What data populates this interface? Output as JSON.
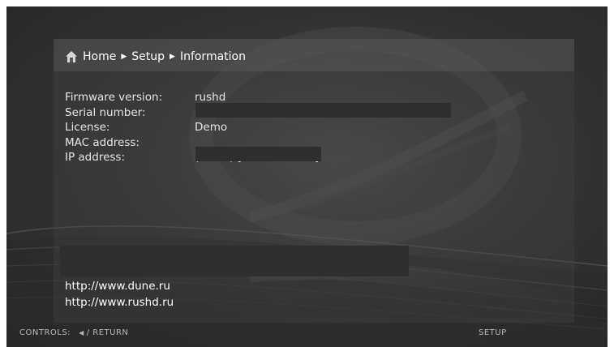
{
  "breadcrumb": {
    "home": "Home",
    "setup": "Setup",
    "current": "Information"
  },
  "info": [
    {
      "label": "Firmware version:",
      "value": "rushd"
    },
    {
      "label": "Serial number:",
      "value": ""
    },
    {
      "label": "License:",
      "value": "Demo"
    },
    {
      "label": "MAC address:",
      "value": ""
    },
    {
      "label": "IP address:",
      "value": "(unset) [disconnected]"
    }
  ],
  "links": [
    "http://www.dune.ru",
    "http://www.rushd.ru"
  ],
  "bottom_bar": {
    "controls_label": "CONTROLS:",
    "return_label": "/ RETURN",
    "section": "SETUP"
  },
  "icons": {
    "breadcrumb_home": "home-icon",
    "separator": "triangle-right-icon",
    "controls_left": "triangle-left-icon"
  }
}
